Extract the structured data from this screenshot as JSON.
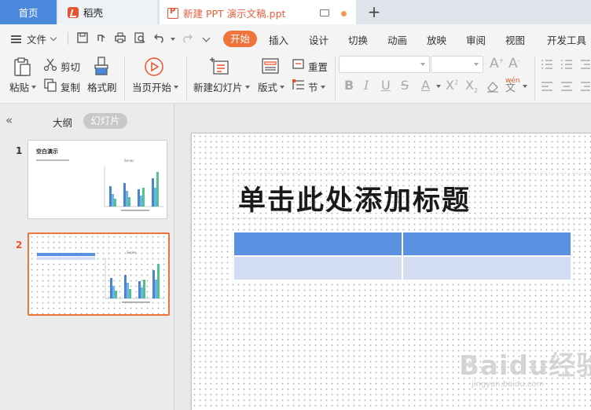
{
  "tabs": {
    "home": "首页",
    "daoke": "稻壳",
    "document": "新建 PPT 演示文稿.ppt",
    "add": "+"
  },
  "menu": {
    "file": "文件",
    "items": [
      "开始",
      "插入",
      "设计",
      "切换",
      "动画",
      "放映",
      "审阅",
      "视图",
      "开发工具"
    ],
    "active": "开始"
  },
  "ribbon": {
    "paste": "粘贴",
    "cut": "剪切",
    "copy": "复制",
    "format_painter": "格式刷",
    "play_from_current": "当页开始",
    "new_slide": "新建幻灯片",
    "layout": "版式",
    "reset": "重置",
    "section": "节",
    "font_name": "",
    "font_size": "",
    "phonetic_label": "wén"
  },
  "left_panel": {
    "tab_outline": "大纲",
    "tab_slides": "幻灯片",
    "slides": [
      {
        "number": "1",
        "title": "空白演示",
        "chart_caption": "Series"
      },
      {
        "number": "2",
        "title": "",
        "chart_caption": "Series"
      }
    ]
  },
  "slide": {
    "title_placeholder": "单击此处添加标题"
  },
  "watermark": {
    "text": "Baidu经验",
    "sub": "jingyan.baidu.com"
  },
  "colors": {
    "accent": "#f0733a",
    "home_tab": "#4a89dc",
    "table_header": "#5b8fe0",
    "table_row": "#d3ddf2",
    "thumb_bar_blue": "#4b85cf",
    "thumb_bar_green": "#4fc38d"
  }
}
